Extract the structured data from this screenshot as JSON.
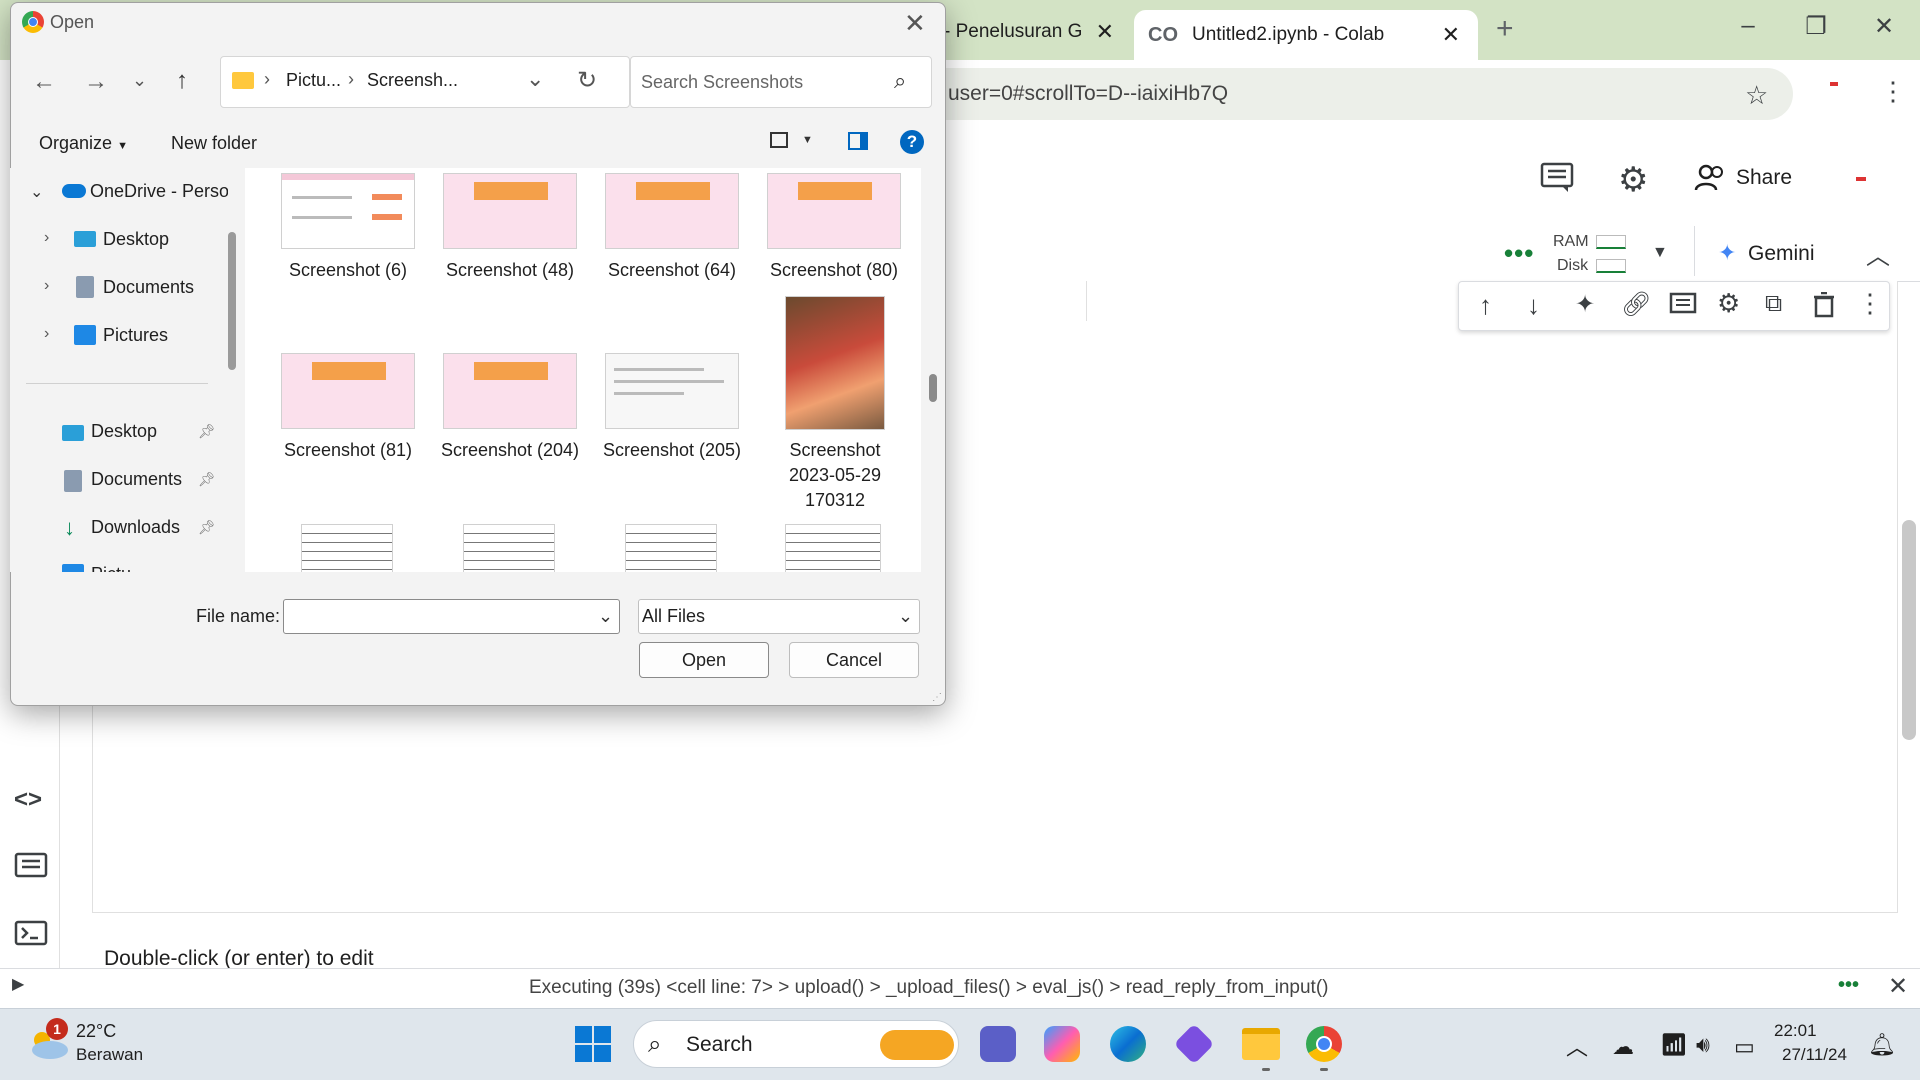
{
  "browser": {
    "tabs": [
      {
        "label": "- Penelusuran G"
      },
      {
        "label": "Untitled2.ipynb - Colab"
      }
    ],
    "url": "user=0#scrollTo=D--iaixiHb7Q"
  },
  "colab": {
    "share_label": "Share",
    "ram_label": "RAM",
    "disk_label": "Disk",
    "gemini_label": "Gemini",
    "text_cell": "Double-click (or enter) to edit",
    "status": "Executing (39s)  <cell line: 7> > upload() > _upload_files() > eval_js() > read_reply_from_input()"
  },
  "dialog": {
    "title": "Open",
    "breadcrumb": [
      "Pictu...",
      "Screensh..."
    ],
    "search_placeholder": "Search Screenshots",
    "organize_label": "Organize",
    "new_folder_label": "New folder",
    "nav_items": [
      {
        "label": "OneDrive - Perso"
      },
      {
        "label": "Desktop"
      },
      {
        "label": "Documents"
      },
      {
        "label": "Pictures"
      }
    ],
    "quick_access": [
      {
        "label": "Desktop"
      },
      {
        "label": "Documents"
      },
      {
        "label": "Downloads"
      },
      {
        "label": "Pictu"
      }
    ],
    "files": [
      {
        "name": "Screenshot (6)",
        "kind": "screenshot-form"
      },
      {
        "name": "Screenshot (48)",
        "kind": "screenshot-pink"
      },
      {
        "name": "Screenshot (64)",
        "kind": "screenshot-pink"
      },
      {
        "name": "Screenshot (80)",
        "kind": "screenshot-pink"
      },
      {
        "name": "Screenshot (81)",
        "kind": "screenshot-pink"
      },
      {
        "name": "Screenshot (204)",
        "kind": "screenshot-pink"
      },
      {
        "name": "Screenshot (205)",
        "kind": "screenshot-doc"
      },
      {
        "name": "Screenshot 2023-05-29 170312",
        "kind": "illustration"
      }
    ],
    "file_name_label": "File name:",
    "file_name_value": "",
    "filter_value": "All Files",
    "open_label": "Open",
    "cancel_label": "Cancel"
  },
  "taskbar": {
    "weather_temp": "22°C",
    "weather_desc": "Berawan",
    "weather_badge": "1",
    "search_label": "Search",
    "time": "22:01",
    "date": "27/11/24"
  },
  "colors": {
    "tabstrip": "#d3e3c5",
    "accent_blue": "#0067c0",
    "gemini_blue": "#4285f4"
  }
}
